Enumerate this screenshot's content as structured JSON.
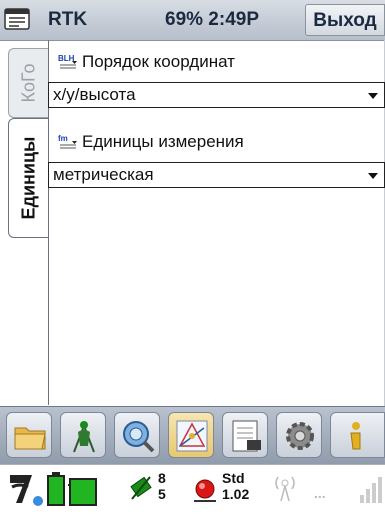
{
  "titlebar": {
    "title": "RTK",
    "status": "69% 2:49P",
    "exit_label": "Выход"
  },
  "tabs": [
    {
      "label": "КоГо",
      "active": false
    },
    {
      "label": "Единицы",
      "active": true
    }
  ],
  "coordinates": {
    "icon_text": "BLH",
    "label": "Порядок координат",
    "value": "x/y/высота"
  },
  "units": {
    "icon_text": "fm",
    "label": "Единицы измерения",
    "value": "метрическая"
  },
  "toolbar": {
    "items": [
      "folder-icon",
      "surveyor-icon",
      "globe-search-icon",
      "cogo-map-icon",
      "notebook-icon",
      "gear-icon",
      "info-icon"
    ]
  },
  "statusbar": {
    "satellites_top": "8",
    "satellites_bottom": "5",
    "solution_label": "Std",
    "solution_value": "1.02",
    "dots": "..."
  },
  "colors": {
    "accent_green": "#1a8a1a",
    "battery_green": "#22b522",
    "alert_red": "#d81818"
  }
}
